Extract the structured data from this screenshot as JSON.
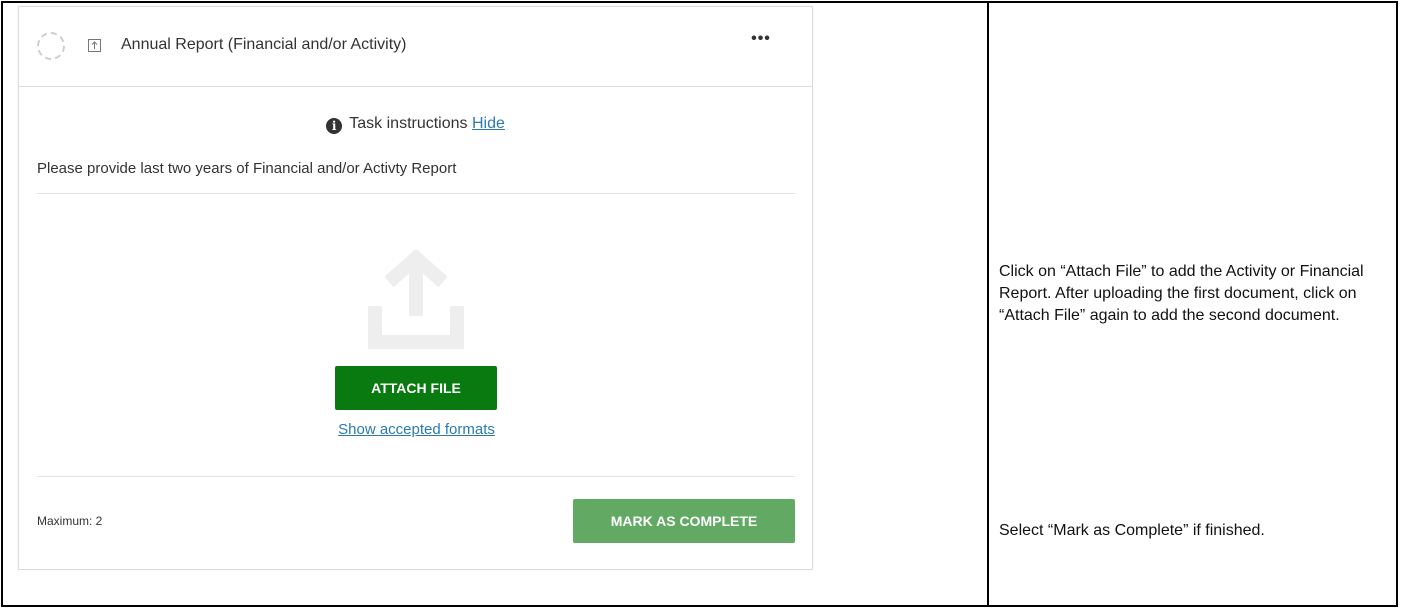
{
  "task": {
    "title": "Annual Report (Financial and/or Activity)",
    "more_label": "•••",
    "instructions_label": "Task instructions",
    "hide_label": "Hide",
    "instruction_text": "Please provide last two years of Financial and/or Activty Report",
    "attach_button": "ATTACH FILE",
    "formats_link": "Show accepted formats",
    "maximum": "Maximum: 2",
    "complete_button": "MARK AS COMPLETE"
  },
  "help": {
    "attach_note": "Click on “Attach File” to add the Activity or Financial Report. After uploading the first document, click on “Attach File” again to add the second document.",
    "complete_note": "Select “Mark as Complete” if finished."
  },
  "colors": {
    "attach_button": "#087a0f",
    "complete_button": "#62aa63",
    "link": "#2a7ab0"
  },
  "icons": {
    "status": "status-circle-icon",
    "task_type": "upload-icon",
    "info": "info-icon",
    "upload_area": "upload-icon"
  }
}
